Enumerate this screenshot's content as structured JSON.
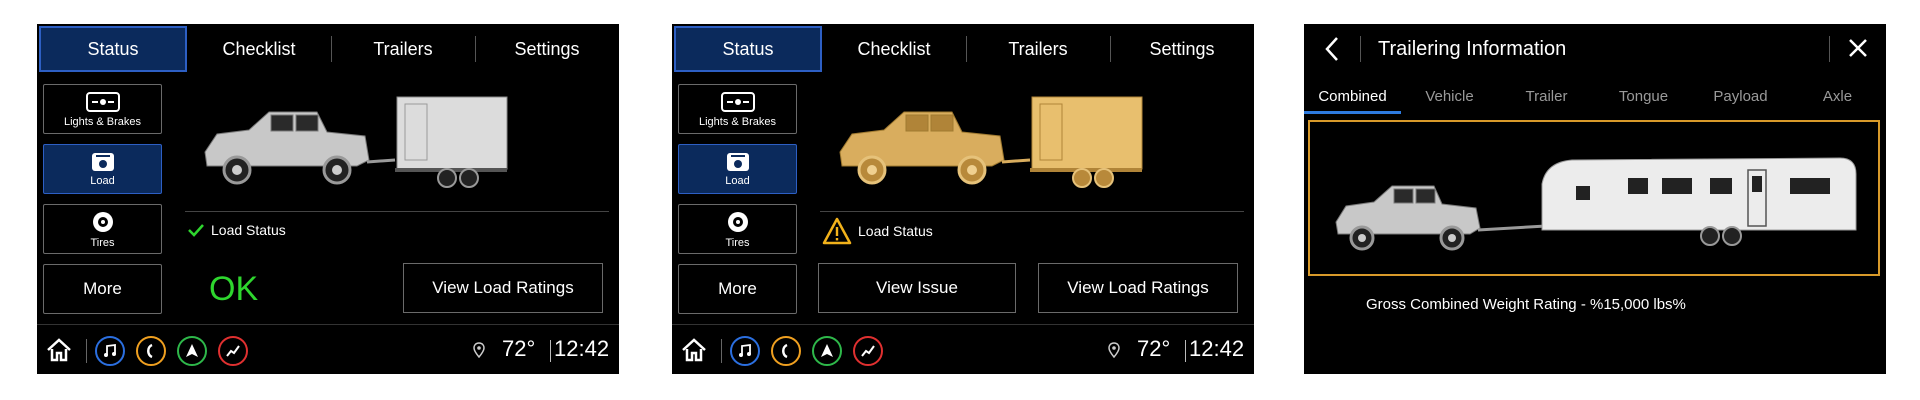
{
  "screens": [
    {
      "tabs": [
        "Status",
        "Checklist",
        "Trailers",
        "Settings"
      ],
      "side_buttons": [
        "Lights & Brakes",
        "Load",
        "Tires"
      ],
      "more_label": "More",
      "status_label": "Load Status",
      "status_state": "ok",
      "ok_text": "OK",
      "view_load_ratings": "View Load Ratings",
      "vehicle_color": "#c8c8c8",
      "temperature": "72°",
      "time": "12:42"
    },
    {
      "tabs": [
        "Status",
        "Checklist",
        "Trailers",
        "Settings"
      ],
      "side_buttons": [
        "Lights & Brakes",
        "Load",
        "Tires"
      ],
      "more_label": "More",
      "status_label": "Load Status",
      "status_state": "warning",
      "view_issue": "View Issue",
      "view_load_ratings": "View Load Ratings",
      "vehicle_color": "#d9ad5e",
      "temperature": "72°",
      "time": "12:42"
    },
    {
      "title": "Trailering Information",
      "tabs": [
        "Combined",
        "Vehicle",
        "Trailer",
        "Tongue",
        "Payload",
        "Axle"
      ],
      "active_tab": "Combined",
      "gcwr_text": "Gross Combined Weight Rating - %15,000 lbs%"
    }
  ],
  "colors": {
    "active_tab_bg": "#0b2a5c",
    "active_border": "#2d5fc4",
    "ok_green": "#2ed62e",
    "warning_amber": "#f2b21b",
    "frame_amber": "#d89a2a",
    "music_blue": "#2b6fe0",
    "phone_orange": "#f0a020",
    "nav_green": "#2eb84a",
    "apps_red": "#e03030"
  },
  "icons": [
    "home-icon",
    "music-icon",
    "phone-icon",
    "navigation-icon",
    "apps-icon",
    "location-pin-icon",
    "back-arrow-icon",
    "close-icon",
    "checkmark-icon",
    "warning-icon",
    "lights-brakes-icon",
    "load-scale-icon",
    "tire-icon"
  ]
}
